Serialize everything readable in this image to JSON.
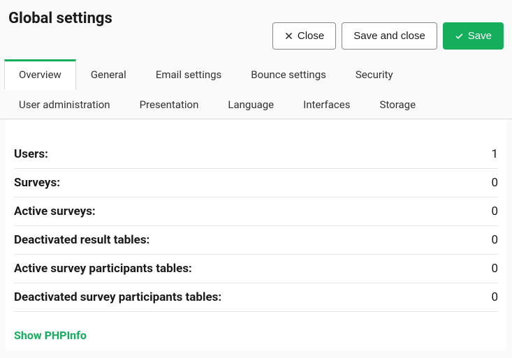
{
  "header": {
    "title": "Global settings"
  },
  "actions": {
    "close": "Close",
    "save_and_close": "Save and close",
    "save": "Save"
  },
  "tabs": [
    {
      "label": "Overview",
      "active": true
    },
    {
      "label": "General",
      "active": false
    },
    {
      "label": "Email settings",
      "active": false
    },
    {
      "label": "Bounce settings",
      "active": false
    },
    {
      "label": "Security",
      "active": false
    },
    {
      "label": "User administration",
      "active": false
    },
    {
      "label": "Presentation",
      "active": false
    },
    {
      "label": "Language",
      "active": false
    },
    {
      "label": "Interfaces",
      "active": false
    },
    {
      "label": "Storage",
      "active": false
    }
  ],
  "stats": [
    {
      "label": "Users:",
      "value": "1"
    },
    {
      "label": "Surveys:",
      "value": "0"
    },
    {
      "label": "Active surveys:",
      "value": "0"
    },
    {
      "label": "Deactivated result tables:",
      "value": "0"
    },
    {
      "label": "Active survey participants tables:",
      "value": "0"
    },
    {
      "label": "Deactivated survey participants tables:",
      "value": "0"
    }
  ],
  "links": {
    "phpinfo": "Show PHPInfo"
  }
}
